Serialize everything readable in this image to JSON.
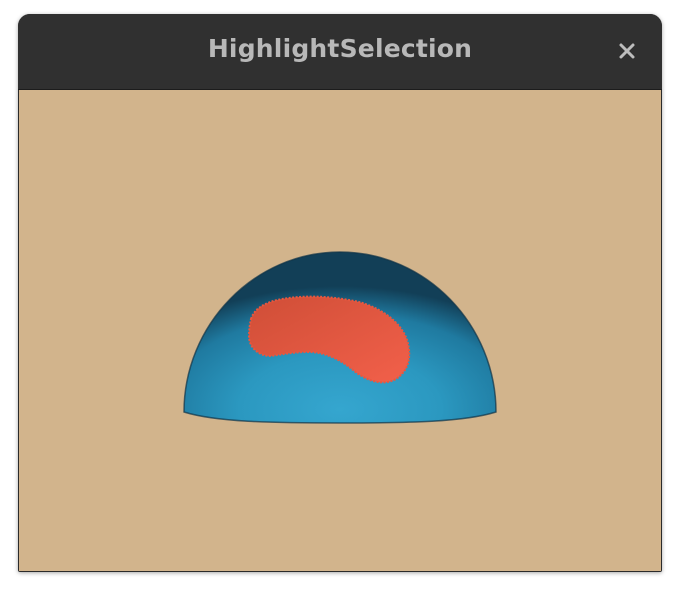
{
  "window": {
    "title": "HighlightSelection"
  },
  "titlebar": {
    "close_icon": "close-icon"
  },
  "colors": {
    "background": "#d2b48c",
    "sphere": "#2e9cc4",
    "selection": "#ee5a43",
    "titlebar": "#303030",
    "title_text": "#b8b8b8"
  }
}
